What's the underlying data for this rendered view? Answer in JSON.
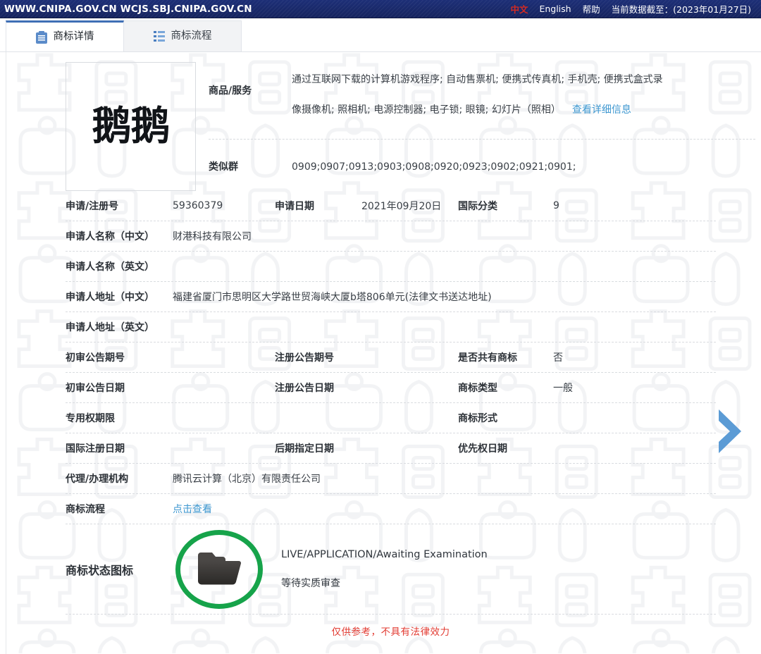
{
  "topbar": {
    "site_urls": "WWW.CNIPA.GOV.CN WCJS.SBJ.CNIPA.GOV.CN",
    "lang_cn": "中文",
    "lang_en": "English",
    "help": "帮助",
    "data_stamp": "当前数据截至：(2023年01月27日)",
    "bg_color": "#17276b",
    "cn_color": "#d42a22"
  },
  "tabs": [
    {
      "label": "商标详情",
      "icon": "clipboard-icon",
      "active": true
    },
    {
      "label": "商标流程",
      "icon": "list-icon",
      "active": false
    }
  ],
  "mark": {
    "text": "鹅鹅",
    "watermark_text": "中国商标"
  },
  "goods": {
    "label": "商品/服务",
    "line1": "通过互联网下载的计算机游戏程序; 自动售票机; 便携式传真机; 手机壳; 便携式盒式录",
    "line2": "像摄像机; 照相机; 电源控制器; 电子锁; 眼镜; 幻灯片（照相）",
    "detail_link": "查看详细信息"
  },
  "similar_group": {
    "label": "类似群",
    "value": "0909;0907;0913;0903;0908;0920;0923;0902;0921;0901;"
  },
  "rows": [
    {
      "c1_label": "申请/注册号",
      "c1_value": "59360379",
      "c2_label": "申请日期",
      "c2_value": "2021年09月20日",
      "c3_label": "国际分类",
      "c3_value": "9"
    },
    {
      "c1_label": "申请人名称（中文）",
      "c1_value": "财港科技有限公司",
      "wide": true
    },
    {
      "c1_label": "申请人名称（英文）",
      "c1_value": "",
      "wide": true
    },
    {
      "c1_label": "申请人地址（中文）",
      "c1_value": "福建省厦门市思明区大学路世贸海峡大厦b塔806单元(法律文书送达地址)",
      "wide": true
    },
    {
      "c1_label": "申请人地址（英文）",
      "c1_value": "",
      "wide": true
    },
    {
      "c1_label": "初审公告期号",
      "c1_value": "",
      "c2_label": "注册公告期号",
      "c2_value": "",
      "c3_label": "是否共有商标",
      "c3_value": "否"
    },
    {
      "c1_label": "初审公告日期",
      "c1_value": "",
      "c2_label": "注册公告日期",
      "c2_value": "",
      "c3_label": "商标类型",
      "c3_value": "一般"
    },
    {
      "c1_label": "专用权期限",
      "c1_value": "",
      "c2_label": "",
      "c2_value": "",
      "c3_label": "商标形式",
      "c3_value": ""
    },
    {
      "c1_label": "国际注册日期",
      "c1_value": "",
      "c2_label": "后期指定日期",
      "c2_value": "",
      "c3_label": "优先权日期",
      "c3_value": ""
    },
    {
      "c1_label": "代理/办理机构",
      "c1_value": "腾讯云计算（北京）有限责任公司",
      "wide": true
    },
    {
      "c1_label": "商标流程",
      "c1_value": "点击查看",
      "wide": true,
      "link": true
    }
  ],
  "status": {
    "label": "商标状态图标",
    "icon": "folder-status-icon",
    "ring_color": "#16a34a",
    "line_en": "LIVE/APPLICATION/Awaiting Examination",
    "line_cn": "等待实质审查"
  },
  "disclaimer": "仅供参考，不具有法律效力",
  "nav": {
    "next_icon": "chevron-right-icon",
    "next_color": "#5b9bd5"
  }
}
